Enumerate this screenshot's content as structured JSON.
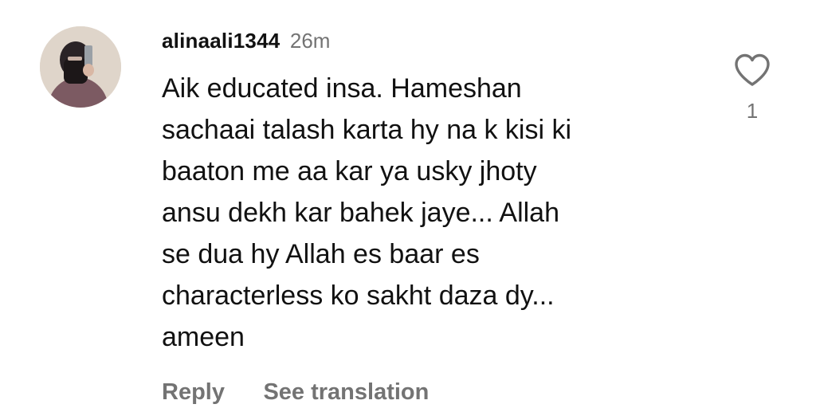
{
  "comment": {
    "username": "alinaali1344",
    "time": "26m",
    "text": "Aik educated insa. Hameshan\nsachaai talash karta hy na k kisi ki\nbaaton me aa kar ya usky jhoty\nansu dekh kar bahek jaye... Allah\nse dua hy Allah es baar es\ncharacterless ko sakht daza dy...\nameen",
    "reply_label": "Reply",
    "translate_label": "See translation",
    "like_count": "1",
    "like_icon": "heart-outline-icon"
  },
  "colors": {
    "text_primary": "#111111",
    "text_secondary": "#737373",
    "background": "#ffffff"
  }
}
